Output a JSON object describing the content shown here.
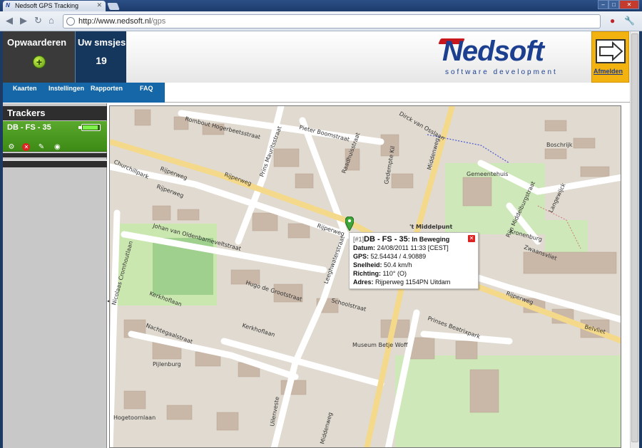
{
  "browser": {
    "tab_title": "Nedsoft GPS Tracking",
    "url_host": "http://www.nedsoft.nl",
    "url_path": "/gps"
  },
  "header": {
    "upgrade_label": "Opwaarderen",
    "sms_label": "Uw smsjes",
    "sms_count": "19",
    "logo_text": "Nedsoft",
    "logo_tagline": "software development",
    "logout_label": "Afmelden"
  },
  "menu": [
    "Kaarten",
    "Instellingen",
    "Rapporten",
    "FAQ"
  ],
  "sidebar": {
    "title": "Trackers",
    "tracker_name": "DB - FS - 35"
  },
  "popup": {
    "index": "[#1]",
    "tracker": "DB - FS - 35",
    "status": ": In Beweging",
    "date_label": "Datum:",
    "date_value": "24/08/2011 11:33 [CEST]",
    "gps_label": "GPS:",
    "gps_value": "52.54434 / 4.90889",
    "speed_label": "Snelheid:",
    "speed_value": "50.4 km/h",
    "heading_label": "Richting:",
    "heading_value": "110°  (O)",
    "address_label": "Adres:",
    "address_value": "Rijperweg 1154PN Uitdam"
  },
  "map_labels": [
    "Rombout Hogerbeetsstraat",
    "Pieter Boomstraat",
    "Raadhuisstraat",
    "Dirck van Osslaan",
    "Rijperweg",
    "Churchillpark",
    "Prins Mauritsstraat",
    "Gedempte Kil",
    "Middenweg",
    "Gemeentehuis",
    "Rijn Middelburgstraat",
    "Langewijck",
    "Boschrijk",
    "Kronenburg",
    "Zwaansvliet",
    "Johan van Oldenbarneveltstraat",
    "Nicolaas Cromhoutlaan",
    "Hugo de Grootstraat",
    "Leeghwaterstraat",
    "Schoolstraat",
    "Kerkhoflaan",
    "Nachtegaalstraat",
    "Pijlenburg",
    "Museum Betje Wolff",
    "Prinses Beatrixpark",
    "Belvliet",
    "Hogetoornlaan",
    "Uilenveste",
    "Middenweg",
    "'t Middelpunt"
  ]
}
